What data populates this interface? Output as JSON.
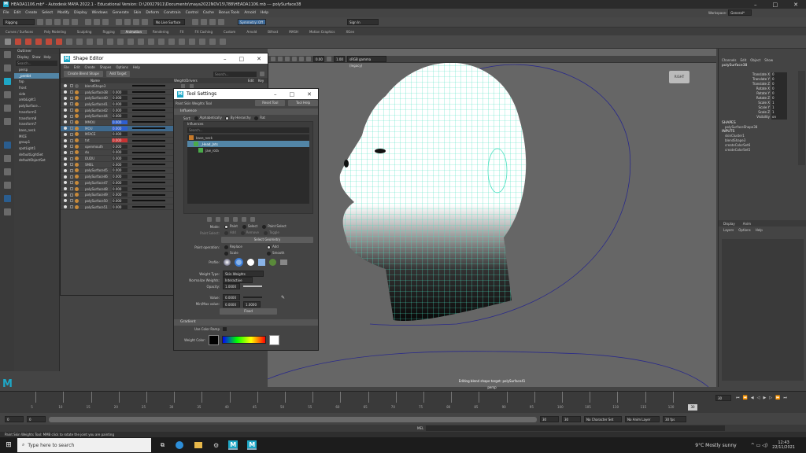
{
  "window": {
    "title": "HEADA1106.mb* - Autodesk MAYA 2022.1 - Educational Version: D:\\20027911\\Documents\\maya2022NOV15\\788\\HEADA1106.mb  ---  polySurface38",
    "workspace_label": "Workspace:",
    "workspace_value": "General*"
  },
  "menu": [
    "File",
    "Edit",
    "Create",
    "Select",
    "Modify",
    "Display",
    "Windows",
    "Generate",
    "Skin",
    "Deform",
    "Constrain",
    "Control",
    "Cache",
    "Bonus Tools",
    "Arnold",
    "Help"
  ],
  "status_line": {
    "mode": "Rigging",
    "live_surface": "No Live Surface",
    "symmetry": "Symmetry: Off",
    "sign_in": "Sign In"
  },
  "shelf_tabs": [
    "Curves / Surfaces",
    "Poly Modeling",
    "Sculpting",
    "Rigging",
    "Animation",
    "Rendering",
    "FX",
    "FX Caching",
    "Custom",
    "Arnold",
    "Bifrost",
    "MASH",
    "Motion Graphics",
    "XGen"
  ],
  "shelf_active_tab": "Animation",
  "outliner": {
    "title": "Outliner",
    "menu": [
      "Display",
      "Show",
      "Help"
    ],
    "search_placeholder": "Search...",
    "items": [
      "persp",
      "_pentbt",
      "top",
      "front",
      "side",
      "ambLight1",
      "polySurface…",
      "transform5",
      "transform8",
      "transform7",
      "base_neck",
      "MICE",
      "group1",
      "spotLight1",
      "defaultLightSet",
      "defaultObjectSet"
    ]
  },
  "shape_editor": {
    "title": "Shape Editor",
    "menu": [
      "File",
      "Edit",
      "Create",
      "Shapes",
      "Options",
      "Help"
    ],
    "create_blend_shape": "Create Blend Shape",
    "add_target": "Add Target",
    "search_placeholder": "Search...",
    "col_name": "Name",
    "col_weight": "Weight/Drivers",
    "col_edit": "Edit",
    "col_key": "Key",
    "rows": [
      {
        "name": "blendShape3",
        "value": ""
      },
      {
        "name": "polySurface38",
        "value": "0.000"
      },
      {
        "name": "polySurface40",
        "value": "0.000"
      },
      {
        "name": "polySurface41",
        "value": "0.000"
      },
      {
        "name": "polySurface42",
        "value": "0.000"
      },
      {
        "name": "polySurface44",
        "value": "0.000"
      },
      {
        "name": "MMOU",
        "value": "0.000"
      },
      {
        "name": "MOU",
        "value": "0.000"
      },
      {
        "name": "MFACE",
        "value": "0.000"
      },
      {
        "name": "tnt",
        "value": "0.000"
      },
      {
        "name": "openmouth",
        "value": "0.000"
      },
      {
        "name": "du",
        "value": "0.000"
      },
      {
        "name": "DUDU",
        "value": "0.000"
      },
      {
        "name": "SMEL",
        "value": "0.000"
      },
      {
        "name": "polySurface45",
        "value": "0.000"
      },
      {
        "name": "polySurface46",
        "value": "0.000"
      },
      {
        "name": "polySurface47",
        "value": "0.000"
      },
      {
        "name": "polySurface48",
        "value": "0.000"
      },
      {
        "name": "polySurface49",
        "value": "0.000"
      },
      {
        "name": "polySurface50",
        "value": "0.000"
      },
      {
        "name": "polySurface51",
        "value": "0.000"
      }
    ]
  },
  "tool_settings": {
    "title": "Tool Settings",
    "tool_name": "Paint Skin Weights Tool",
    "reset_tool": "Reset Tool",
    "tool_help": "Tool Help",
    "influence_header": "Influence",
    "sort_label": "Sort:",
    "sort_options": [
      "Alphabetically",
      "By Hierarchy",
      "Flat"
    ],
    "influences_label": "Influences",
    "search_placeholder": "Search...",
    "influences": [
      "base_neck",
      "_Head_Jnts",
      "jaw_rota"
    ],
    "mode_label": "Mode:",
    "mode_options": [
      "Paint",
      "Select",
      "Paint Select"
    ],
    "paint_select_label": "Paint Select:",
    "paint_select_options": [
      "Add",
      "Remove",
      "Toggle"
    ],
    "select_geometry": "Select Geometry",
    "paint_operation_label": "Paint operation:",
    "paint_ops": [
      "Replace",
      "Add",
      "Scale",
      "Smooth"
    ],
    "profile_label": "Profile:",
    "weight_type_label": "Weight Type:",
    "weight_type_value": "Skin Weights",
    "normalize_label": "Normalize Weights:",
    "normalize_value": "Interactive",
    "opacity_label": "Opacity:",
    "opacity_value": "1.0000",
    "value_label": "Value:",
    "value_value": "0.0000",
    "minmax_label": "Min/Max value:",
    "min_value": "0.0000",
    "max_value": "1.0000",
    "flood": "Flood",
    "gradient_header": "Gradient",
    "use_color_ramp": "Use Color Ramp",
    "weight_color_label": "Weight Color:"
  },
  "viewport": {
    "renderer": "sRGB gamma (legacy)",
    "values": [
      "0.00",
      "1.00"
    ],
    "view_cube_label": "RIGHT",
    "editing_message": "Editing blend shape target: polySurface41",
    "camera": "persp"
  },
  "channel_box": {
    "menu": [
      "Channels",
      "Edit",
      "Object",
      "Show"
    ],
    "object": "polySurface38",
    "attrs": [
      {
        "name": "Translate X",
        "value": "0"
      },
      {
        "name": "Translate Y",
        "value": "0"
      },
      {
        "name": "Translate Z",
        "value": "0"
      },
      {
        "name": "Rotate X",
        "value": "0"
      },
      {
        "name": "Rotate Y",
        "value": "0"
      },
      {
        "name": "Rotate Z",
        "value": "0"
      },
      {
        "name": "Scale X",
        "value": "1"
      },
      {
        "name": "Scale Y",
        "value": "1"
      },
      {
        "name": "Scale Z",
        "value": "1"
      },
      {
        "name": "Visibility",
        "value": "on"
      }
    ],
    "shapes_header": "SHAPES",
    "shapes": [
      "polySurfaceShape38"
    ],
    "inputs_header": "INPUTS",
    "inputs": [
      "skinCluster1",
      "blendShape3",
      "createColorSet6",
      "createColorSet5"
    ],
    "layer_tabs": [
      "Display",
      "Anim"
    ],
    "layer_menu": [
      "Layers",
      "Options",
      "Help"
    ]
  },
  "timeline": {
    "ticks": [
      "5",
      "10",
      "15",
      "20",
      "25",
      "30",
      "35",
      "40",
      "45",
      "50",
      "55",
      "60",
      "65",
      "70",
      "75",
      "80",
      "85",
      "90",
      "95",
      "100",
      "105",
      "110",
      "115",
      "120"
    ],
    "current_frame": "30",
    "frame_field": "30",
    "range_start": "0",
    "range_start2": "0",
    "range_end": "30",
    "range_end2": "30",
    "character_set": "No Character Set",
    "anim_layer": "No Anim Layer",
    "fps": "30 fps"
  },
  "command_line": {
    "lang": "MEL"
  },
  "help_line": "Paint Skin Weights Tool: MMB click to rotate the joint you are painting",
  "taskbar": {
    "search_placeholder": "Type here to search",
    "weather": "9°C  Mostly sunny",
    "time": "12:43",
    "date": "22/11/2021"
  }
}
